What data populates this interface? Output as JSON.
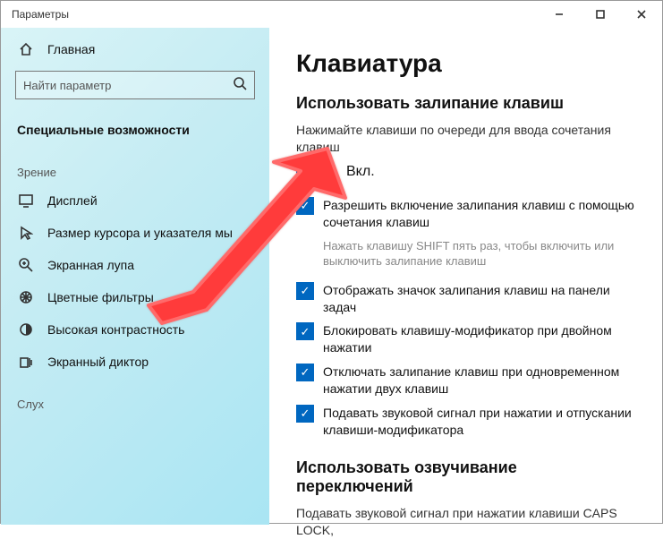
{
  "window": {
    "title": "Параметры"
  },
  "sidebar": {
    "home": "Главная",
    "searchPlaceholder": "Найти параметр",
    "section": "Специальные возможности",
    "group1": "Зрение",
    "items": [
      "Дисплей",
      "Размер курсора и указателя мы",
      "Экранная лупа",
      "Цветные фильтры",
      "Высокая контрастность",
      "Экранный диктор"
    ],
    "group2": "Слух"
  },
  "content": {
    "title": "Клавиатура",
    "section1": "Использовать залипание клавиш",
    "desc1": "Нажимайте клавиши по очереди для ввода сочетания клавиш",
    "toggleLabel": "Вкл.",
    "check1": "Разрешить включение залипания клавиш с помощью сочетания клавиш",
    "hint1": "Нажать клавишу SHIFT пять раз, чтобы включить или выключить залипание клавиш",
    "check2": "Отображать значок залипания клавиш на панели задач",
    "check3": "Блокировать клавишу-модификатор при двойном нажатии",
    "check4": "Отключать залипание клавиш при одновременном нажатии двух клавиш",
    "check5": "Подавать звуковой сигнал при нажатии и отпускании клавиши-модификатора",
    "section2": "Использовать озвучивание переключений",
    "desc2": "Подавать звуковой сигнал при нажатии клавиши CAPS LOCK,"
  }
}
